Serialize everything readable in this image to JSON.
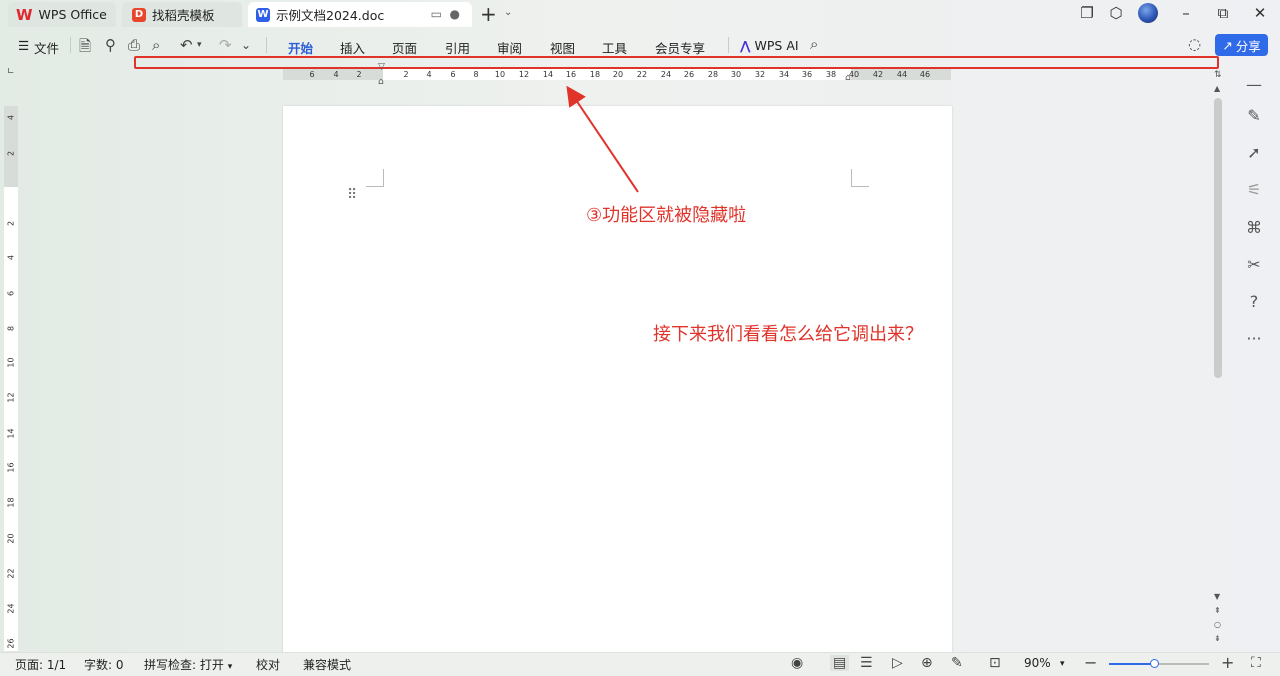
{
  "tabs": [
    {
      "label": "WPS Office"
    },
    {
      "label": "找稻壳模板"
    },
    {
      "label": "示例文档2024.doc"
    }
  ],
  "menubar": {
    "file_label": "文件",
    "items": [
      "开始",
      "插入",
      "页面",
      "引用",
      "审阅",
      "视图",
      "工具",
      "会员专享"
    ],
    "wps_ai": "WPS AI",
    "share": "分享"
  },
  "ruler": {
    "h_ticks": [
      "6",
      "4",
      "2",
      "2",
      "4",
      "6",
      "8",
      "10",
      "12",
      "14",
      "16",
      "18",
      "20",
      "22",
      "24",
      "26",
      "28",
      "30",
      "32",
      "34",
      "36",
      "38",
      "40",
      "42",
      "44",
      "46"
    ],
    "v_ticks": [
      "4",
      "2",
      "2",
      "4",
      "6",
      "8",
      "10",
      "12",
      "14",
      "16",
      "18",
      "20",
      "22",
      "24",
      "26"
    ]
  },
  "annotations": {
    "step3": "③功能区就被隐藏啦",
    "next": "接下来我们看看怎么给它调出来？"
  },
  "statusbar": {
    "page": "页面: 1/1",
    "words": "字数: 0",
    "spell": "拼写检查: 打开",
    "proof": "校对",
    "compat": "兼容模式",
    "zoom": "90%",
    "zoom_level_percent": 45
  },
  "colors": {
    "accent": "#2f6ae8",
    "annotation_red": "#e0342b",
    "wps_red": "#e0282f"
  }
}
